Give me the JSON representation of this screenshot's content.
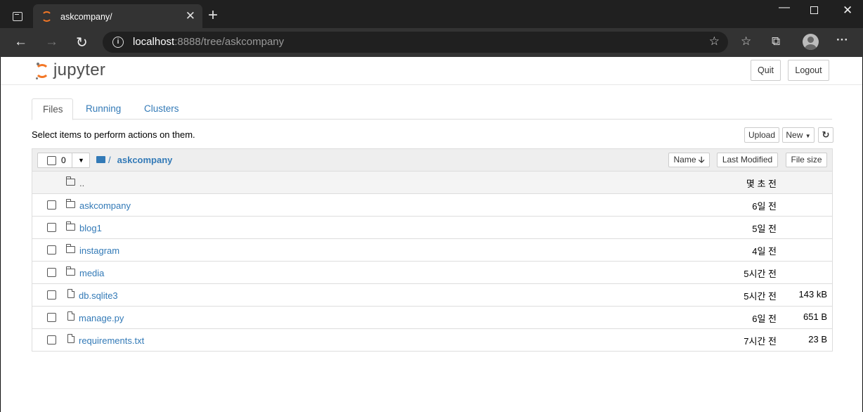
{
  "browser": {
    "tab_title": "askcompany/",
    "url_host": "localhost",
    "url_rest": ":8888/tree/askcompany"
  },
  "jupyter": {
    "logo_text": "jupyter",
    "quit_label": "Quit",
    "logout_label": "Logout",
    "tabs": [
      {
        "label": "Files",
        "active": true
      },
      {
        "label": "Running",
        "active": false
      },
      {
        "label": "Clusters",
        "active": false
      }
    ],
    "hint": "Select items to perform actions on them.",
    "upload_label": "Upload",
    "new_label": "New",
    "selected_count": "0",
    "breadcrumb_sep": "/",
    "current_dir": "askcompany",
    "columns": {
      "name": "Name",
      "last_modified": "Last Modified",
      "file_size": "File size"
    },
    "rows": [
      {
        "name": "..",
        "type": "updir",
        "modified": "몇 초 전",
        "size": ""
      },
      {
        "name": "askcompany",
        "type": "folder",
        "modified": "6일 전",
        "size": ""
      },
      {
        "name": "blog1",
        "type": "folder",
        "modified": "5일 전",
        "size": ""
      },
      {
        "name": "instagram",
        "type": "folder",
        "modified": "4일 전",
        "size": ""
      },
      {
        "name": "media",
        "type": "folder",
        "modified": "5시간 전",
        "size": ""
      },
      {
        "name": "db.sqlite3",
        "type": "file",
        "modified": "5시간 전",
        "size": "143 kB"
      },
      {
        "name": "manage.py",
        "type": "file",
        "modified": "6일 전",
        "size": "651 B"
      },
      {
        "name": "requirements.txt",
        "type": "file",
        "modified": "7시간 전",
        "size": "23 B"
      }
    ],
    "colors": {
      "accent": "#f37726",
      "link": "#337ab7"
    }
  }
}
